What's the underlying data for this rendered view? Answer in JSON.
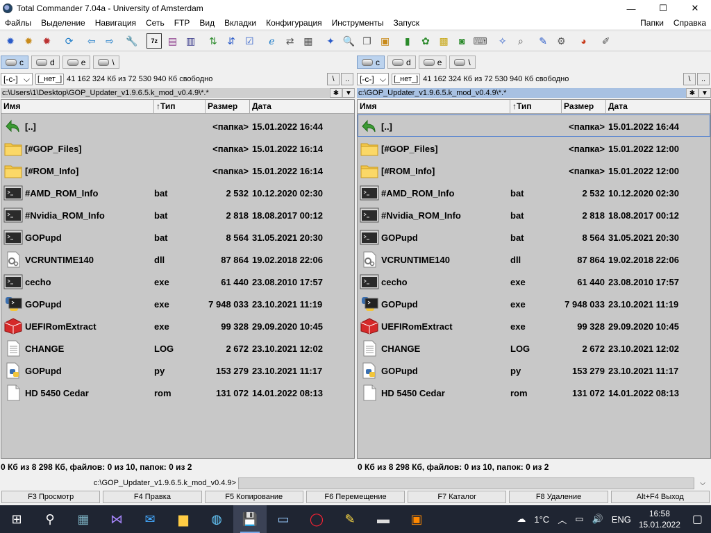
{
  "window": {
    "title": "Total Commander 7.04a - University of Amsterdam",
    "min": "—",
    "max": "☐",
    "close": "✕"
  },
  "menu": {
    "items": [
      "Файлы",
      "Выделение",
      "Навигация",
      "Сеть",
      "FTP",
      "Вид",
      "Вкладки",
      "Конфигурация",
      "Инструменты",
      "Запуск"
    ],
    "right": [
      "Папки",
      "Справка"
    ]
  },
  "drives": [
    {
      "label": "c",
      "active": true
    },
    {
      "label": "d"
    },
    {
      "label": "e"
    },
    {
      "label": "\\"
    }
  ],
  "left": {
    "drive": "[-c-]",
    "volume": "[_нет_]",
    "free": "41 162 324 Кб из 72 530 940 Кб свободно",
    "path": "c:\\Users\\1\\Desktop\\GOP_Updater_v1.9.6.5.k_mod_v0.4.9\\*.*",
    "status": "0 Кб из 8 298 Кб, файлов: 0 из 10, папок: 0 из 2",
    "files": [
      {
        "name": "[..]",
        "ext": "",
        "size": "<папка>",
        "date": "15.01.2022 16:44",
        "icon": "up-icon"
      },
      {
        "name": "[#GOP_Files]",
        "ext": "",
        "size": "<папка>",
        "date": "15.01.2022 16:14",
        "icon": "folder-icon"
      },
      {
        "name": "[#ROM_Info]",
        "ext": "",
        "size": "<папка>",
        "date": "15.01.2022 16:14",
        "icon": "folder-icon"
      },
      {
        "name": "#AMD_ROM_Info",
        "ext": "bat",
        "size": "2 532",
        "date": "10.12.2020 02:30",
        "icon": "console-icon"
      },
      {
        "name": "#Nvidia_ROM_Info",
        "ext": "bat",
        "size": "2 818",
        "date": "18.08.2017 00:12",
        "icon": "console-icon"
      },
      {
        "name": "GOPupd",
        "ext": "bat",
        "size": "8 564",
        "date": "31.05.2021 20:30",
        "icon": "console-icon"
      },
      {
        "name": "VCRUNTIME140",
        "ext": "dll",
        "size": "87 864",
        "date": "19.02.2018 22:06",
        "icon": "dll-icon"
      },
      {
        "name": "cecho",
        "ext": "exe",
        "size": "61 440",
        "date": "23.08.2010 17:57",
        "icon": "console-icon"
      },
      {
        "name": "GOPupd",
        "ext": "exe",
        "size": "7 948 033",
        "date": "23.10.2021 11:19",
        "icon": "python-exe-icon"
      },
      {
        "name": "UEFIRomExtract",
        "ext": "exe",
        "size": "99 328",
        "date": "29.09.2020 10:45",
        "icon": "cube-icon"
      },
      {
        "name": "CHANGE",
        "ext": "LOG",
        "size": "2 672",
        "date": "23.10.2021 12:02",
        "icon": "text-file-icon"
      },
      {
        "name": "GOPupd",
        "ext": "py",
        "size": "153 279",
        "date": "23.10.2021 11:17",
        "icon": "python-file-icon"
      },
      {
        "name": "HD 5450 Cedar",
        "ext": "rom",
        "size": "131 072",
        "date": "14.01.2022 08:13",
        "icon": "blank-file-icon"
      }
    ]
  },
  "right": {
    "drive": "[-c-]",
    "volume": "[_нет_]",
    "free": "41 162 324 Кб из 72 530 940 Кб свободно",
    "path": "c:\\GOP_Updater_v1.9.6.5.k_mod_v0.4.9\\*.*",
    "status": "0 Кб из 8 298 Кб, файлов: 0 из 10, папок: 0 из 2",
    "files": [
      {
        "name": "[..]",
        "ext": "",
        "size": "<папка>",
        "date": "15.01.2022 16:44",
        "icon": "up-icon"
      },
      {
        "name": "[#GOP_Files]",
        "ext": "",
        "size": "<папка>",
        "date": "15.01.2022 12:00",
        "icon": "folder-icon"
      },
      {
        "name": "[#ROM_Info]",
        "ext": "",
        "size": "<папка>",
        "date": "15.01.2022 12:00",
        "icon": "folder-icon"
      },
      {
        "name": "#AMD_ROM_Info",
        "ext": "bat",
        "size": "2 532",
        "date": "10.12.2020 02:30",
        "icon": "console-icon"
      },
      {
        "name": "#Nvidia_ROM_Info",
        "ext": "bat",
        "size": "2 818",
        "date": "18.08.2017 00:12",
        "icon": "console-icon"
      },
      {
        "name": "GOPupd",
        "ext": "bat",
        "size": "8 564",
        "date": "31.05.2021 20:30",
        "icon": "console-icon"
      },
      {
        "name": "VCRUNTIME140",
        "ext": "dll",
        "size": "87 864",
        "date": "19.02.2018 22:06",
        "icon": "dll-icon"
      },
      {
        "name": "cecho",
        "ext": "exe",
        "size": "61 440",
        "date": "23.08.2010 17:57",
        "icon": "console-icon"
      },
      {
        "name": "GOPupd",
        "ext": "exe",
        "size": "7 948 033",
        "date": "23.10.2021 11:19",
        "icon": "python-exe-icon"
      },
      {
        "name": "UEFIRomExtract",
        "ext": "exe",
        "size": "99 328",
        "date": "29.09.2020 10:45",
        "icon": "cube-icon"
      },
      {
        "name": "CHANGE",
        "ext": "LOG",
        "size": "2 672",
        "date": "23.10.2021 12:02",
        "icon": "text-file-icon"
      },
      {
        "name": "GOPupd",
        "ext": "py",
        "size": "153 279",
        "date": "23.10.2021 11:17",
        "icon": "python-file-icon"
      },
      {
        "name": "HD 5450 Cedar",
        "ext": "rom",
        "size": "131 072",
        "date": "14.01.2022 08:13",
        "icon": "blank-file-icon"
      }
    ]
  },
  "columns": {
    "name": "Имя",
    "ext": "↑Тип",
    "size": "Размер",
    "date": "Дата"
  },
  "cmdline": {
    "prompt": "c:\\GOP_Updater_v1.9.6.5.k_mod_v0.4.9>"
  },
  "fkeys": [
    "F3 Просмотр",
    "F4 Правка",
    "F5 Копирование",
    "F6 Перемещение",
    "F7 Каталог",
    "F8 Удаление",
    "Alt+F4 Выход"
  ],
  "taskbar": {
    "temp": "1°C",
    "lang": "ENG",
    "time": "16:58",
    "date": "15.01.2022"
  },
  "colors": {
    "active_path": "#a8c1e2",
    "list_bg": "#c8c8c8",
    "taskbar": "#1f2532"
  }
}
